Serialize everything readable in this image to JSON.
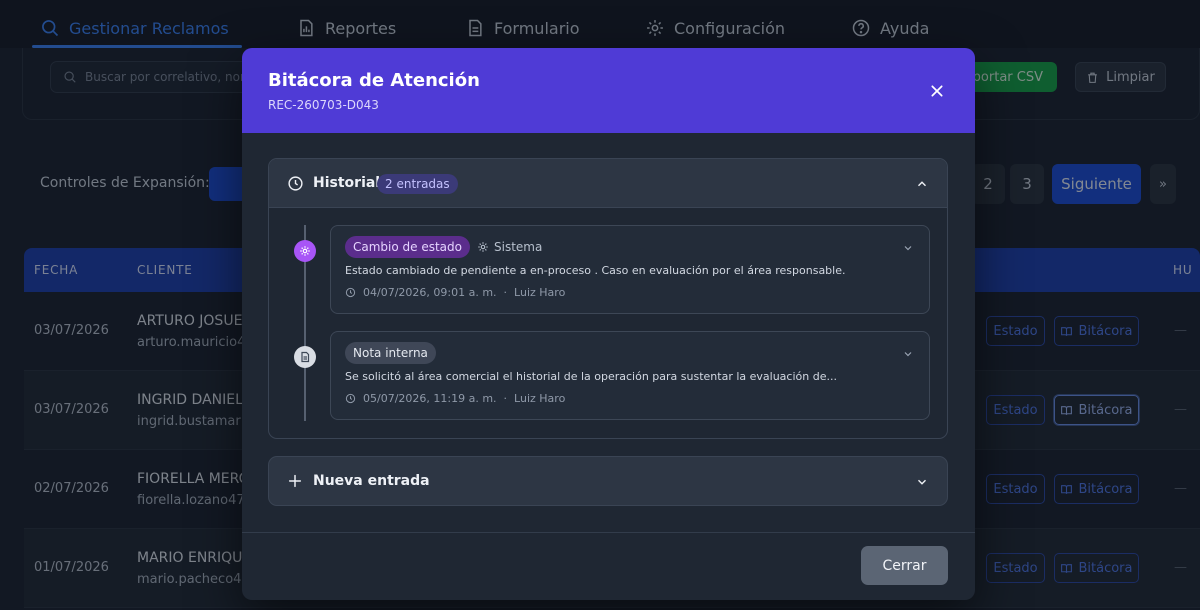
{
  "nav": {
    "tabs": [
      {
        "label": "Gestionar Reclamos",
        "icon": "search-icon"
      },
      {
        "label": "Reportes",
        "icon": "report-icon"
      },
      {
        "label": "Formulario",
        "icon": "document-icon"
      },
      {
        "label": "Configuración",
        "icon": "gear-icon"
      },
      {
        "label": "Ayuda",
        "icon": "help-icon"
      }
    ]
  },
  "toolbar": {
    "search_placeholder": "Buscar por correlativo, nom",
    "export_label": "xportar CSV",
    "clear_label": "Limpiar"
  },
  "expansion": {
    "label": "Controles de Expansión:"
  },
  "pagination": {
    "pages": [
      "2",
      "3"
    ],
    "next_label": "Siguiente",
    "last_label": "»"
  },
  "table": {
    "columns": [
      "FECHA",
      "CLIENTE",
      "HU"
    ],
    "rows": [
      {
        "date": "03/07/2026",
        "name": "ARTURO JOSUE",
        "email": "arturo.mauricio4",
        "estado": "Estado",
        "bitacora": "Bitácora",
        "extra": "—"
      },
      {
        "date": "03/07/2026",
        "name": "INGRID DANIELA",
        "email": "ingrid.bustamar",
        "estado": "Estado",
        "bitacora": "Bitácora",
        "extra": "—"
      },
      {
        "date": "02/07/2026",
        "name": "FIORELLA MERC",
        "email": "fiorella.lozano47",
        "estado": "Estado",
        "bitacora": "Bitácora",
        "extra": "—"
      },
      {
        "date": "01/07/2026",
        "name": "MARIO ENRIQU",
        "email": "mario.pacheco4",
        "estado": "Estado",
        "bitacora": "Bitácora",
        "extra": "—"
      }
    ]
  },
  "modal": {
    "title": "Bitácora de Atención",
    "subtitle": "REC-260703-D043",
    "history_title": "Historial",
    "history_badge": "2 entradas",
    "entries": [
      {
        "tag": "Cambio de estado",
        "actor": "Sistema",
        "text": "Estado cambiado de pendiente a en-proceso . Caso en evaluación por el área responsable.",
        "timestamp": "04/07/2026, 09:01 a. m.",
        "separator": "·",
        "author": "Luiz Haro"
      },
      {
        "tag": "Nota interna",
        "actor": "",
        "text": "Se solicitó al área comercial el historial de la operación para sustentar la evaluación de...",
        "timestamp": "05/07/2026, 11:19 a. m.",
        "separator": "·",
        "author": "Luiz Haro"
      }
    ],
    "new_entry_label": "Nueva entrada",
    "close_label": "Cerrar"
  },
  "colors": {
    "accent": "#4f3bd6",
    "primary": "#1d4ed8",
    "export": "#16a34a",
    "state_change_tag": "#5b2d8c",
    "note_tag": "#3f4757"
  }
}
